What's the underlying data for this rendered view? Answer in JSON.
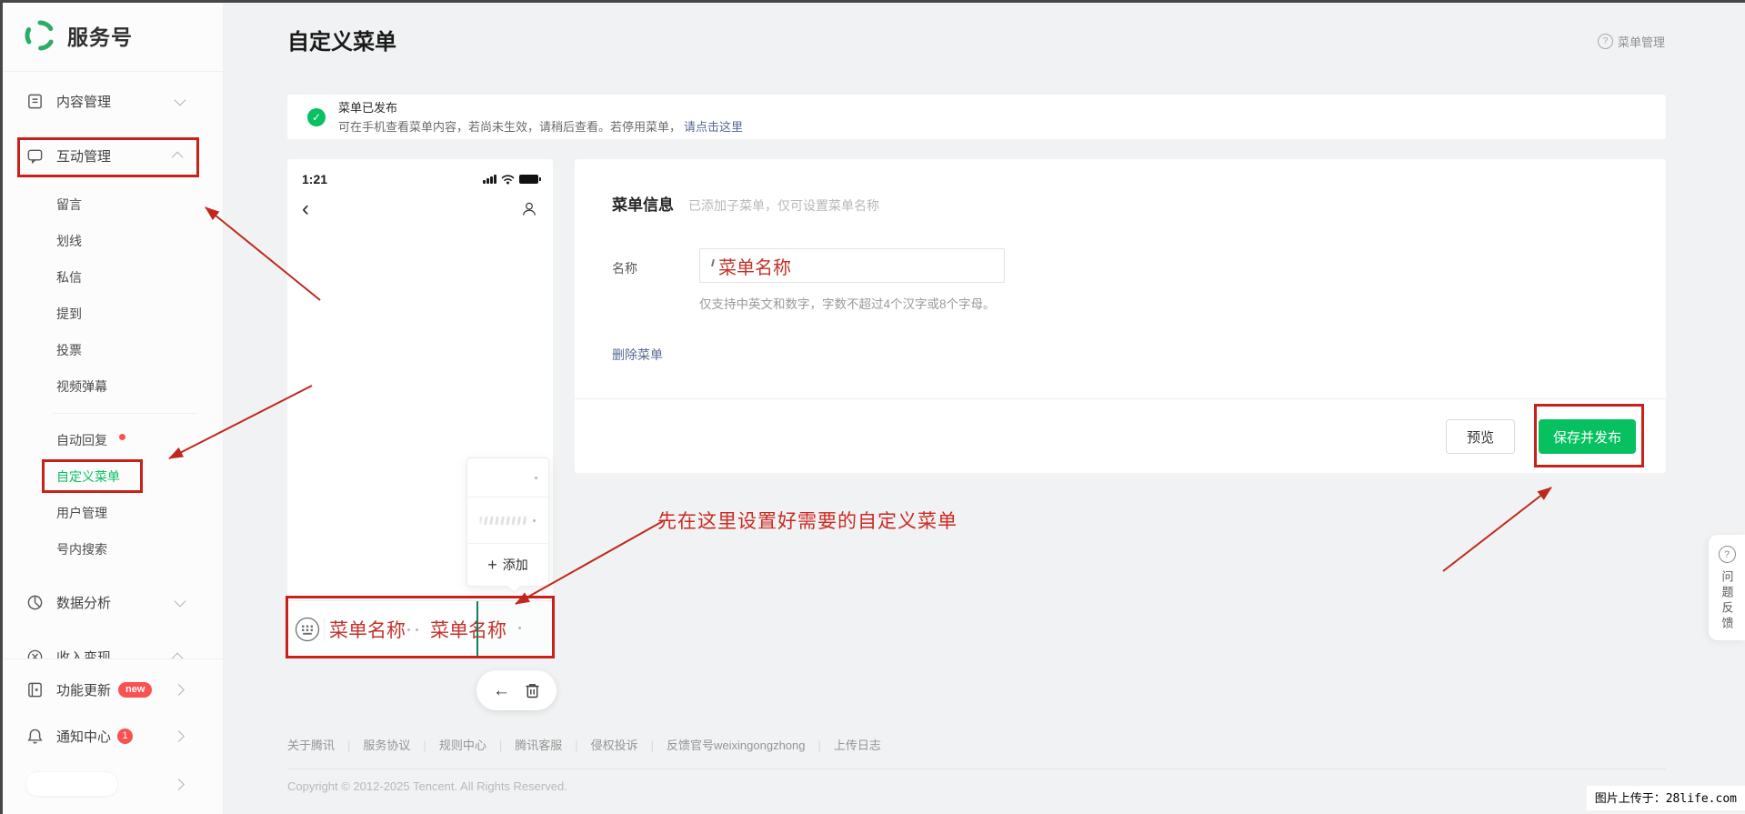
{
  "brand": {
    "name": "服务号"
  },
  "sidebar": {
    "items": [
      {
        "label": "内容管理"
      },
      {
        "label": "互动管理"
      },
      {
        "label": "留言"
      },
      {
        "label": "划线"
      },
      {
        "label": "私信"
      },
      {
        "label": "提到"
      },
      {
        "label": "投票"
      },
      {
        "label": "视频弹幕"
      },
      {
        "label": "自动回复"
      },
      {
        "label": "自定义菜单"
      },
      {
        "label": "用户管理"
      },
      {
        "label": "号内搜索"
      },
      {
        "label": "数据分析"
      },
      {
        "label": "收入变现"
      },
      {
        "label": "功能更新",
        "badge": "new"
      },
      {
        "label": "通知中心",
        "badge": "1"
      }
    ]
  },
  "header": {
    "title": "自定义菜单",
    "help_label": "菜单管理",
    "help_icon": "?"
  },
  "notice": {
    "title": "菜单已发布",
    "body": "可在手机查看菜单内容，若尚未生效，请稍后查看。若停用菜单，",
    "link": "请点击这里",
    "check_icon": "✓"
  },
  "phone": {
    "time": "1:21",
    "back_icon": "‹",
    "menu": {
      "name1": "菜单名称",
      "name2": "菜单名称"
    },
    "popup": {
      "add_icon": "+",
      "add_label": "添加"
    },
    "toolbar": {
      "back_icon": "←"
    }
  },
  "form": {
    "section_title": "菜单信息",
    "section_desc": "已添加子菜单，仅可设置菜单名称",
    "name_label": "名称",
    "name_value": "菜单名称",
    "hint": "仅支持中英文和数字，字数不超过4个汉字或8个字母。",
    "delete_link": "删除菜单",
    "preview_label": "预览",
    "save_label": "保存并发布"
  },
  "annotation": {
    "tip": "先在这里设置好需要的自定义菜单"
  },
  "footer": {
    "links": [
      "关于腾讯",
      "服务协议",
      "规则中心",
      "腾讯客服",
      "侵权投诉",
      "反馈官号weixingongzhong",
      "上传日志"
    ],
    "separator": "|",
    "copyright": "Copyright © 2012-2025 Tencent. All Rights Reserved."
  },
  "feedback": {
    "icon": "?",
    "label": "问题反馈"
  },
  "watermark": {
    "text": "图片上传于：28life.com"
  },
  "colors": {
    "brand_green": "#07c160",
    "logo_green": "#2aae67",
    "annotation_red": "#c9211a",
    "link_blue": "#576b95",
    "badge_red": "#fa5151"
  }
}
